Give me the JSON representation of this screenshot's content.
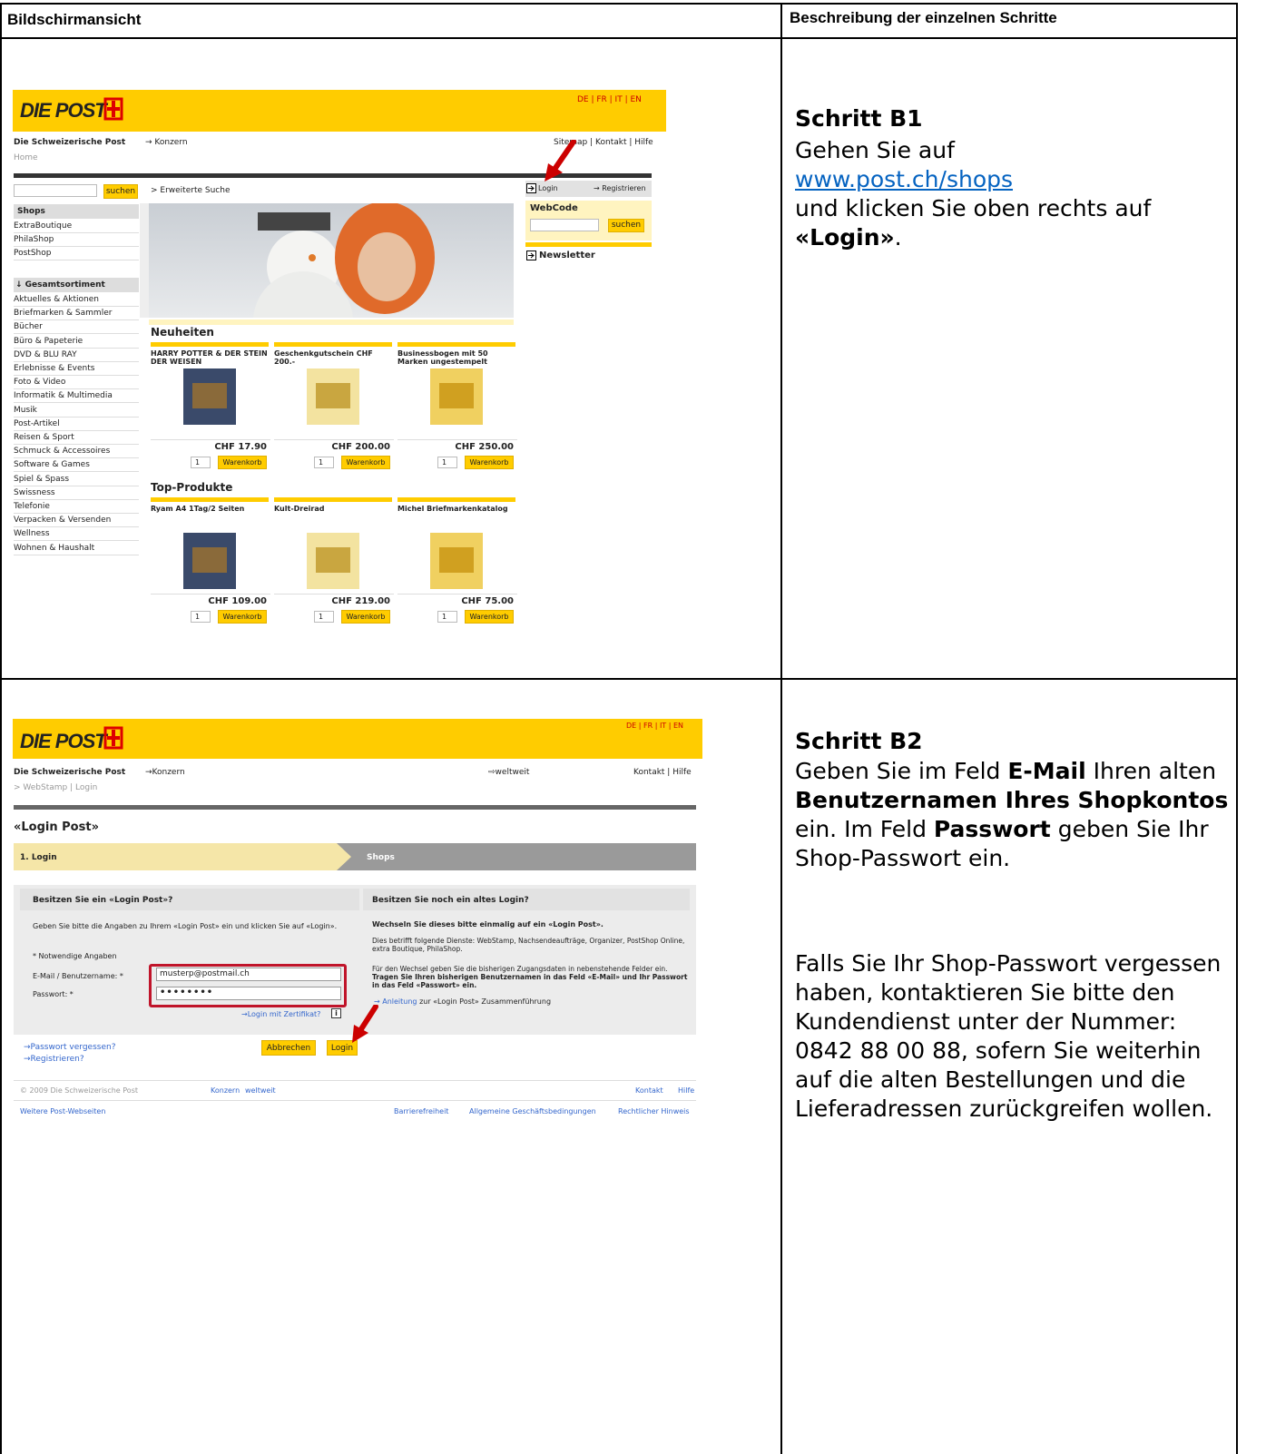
{
  "header": {
    "left": "Bildschirmansicht",
    "right": "Beschreibung der einzelnen Schritte"
  },
  "step1": {
    "title": "Schritt B1",
    "line1": "Gehen Sie auf",
    "link": "www.post.ch/shops",
    "line2": "und klicken Sie oben rechts auf",
    "bold": "«Login»",
    "dot": "."
  },
  "step2": {
    "title": "Schritt B2",
    "p1": [
      "Geben Sie im Feld ",
      "E-Mail",
      " Ihren alten ",
      "Benutzernamen Ihres Shopkontos",
      " ein. Im Feld ",
      "Passwort",
      " geben Sie Ihr Shop-Passwort ein."
    ],
    "p2": "Falls Sie Ihr Shop-Passwort vergessen haben, kontaktieren Sie bitte den Kundendienst unter der Nummer: 0842 88 00 88, sofern Sie weiterhin auf die alten Bestellungen und die Lieferadressen zurückgreifen wollen."
  },
  "shot1": {
    "logo": "DIE POST",
    "lang": "DE | FR | IT | EN",
    "org": "Die Schweizerische Post",
    "konzern": "→ Konzern",
    "toplinks": "Sitemap | Kontakt | Hilfe",
    "home": "Home",
    "search_btn": "suchen",
    "ext_search": "> Erweiterte Suche",
    "login": "Login",
    "register": "→ Registrieren",
    "webcode": "WebCode",
    "webcode_btn": "suchen",
    "newsletter": "Newsletter",
    "shops_title": "Shops",
    "shops": [
      "ExtraBoutique",
      "PhilaShop",
      "PostShop"
    ],
    "sortiment_title": "↓ Gesamtsortiment",
    "sortiment": [
      "Aktuelles & Aktionen",
      "Briefmarken & Sammler",
      "Bücher",
      "Büro & Papeterie",
      "DVD & BLU RAY",
      "Erlebnisse & Events",
      "Foto & Video",
      "Informatik & Multimedia",
      "Musik",
      "Post-Artikel",
      "Reisen & Sport",
      "Schmuck & Accessoires",
      "Software & Games",
      "Spiel & Spass",
      "Swissness",
      "Telefonie",
      "Verpacken & Versenden",
      "Wellness",
      "Wohnen & Haushalt"
    ],
    "neuheiten": "Neuheiten",
    "neu_items": [
      {
        "name": "HARRY POTTER & DER STEIN DER WEISEN",
        "price": "CHF 17.90"
      },
      {
        "name": "Geschenkgutschein CHF 200.-",
        "price": "CHF 200.00"
      },
      {
        "name": "Businessbogen mit 50 Marken ungestempelt",
        "price": "CHF 250.00"
      }
    ],
    "top": "Top-Produkte",
    "top_items": [
      {
        "name": "Ryam A4 1Tag/2 Seiten",
        "price": "CHF 109.00"
      },
      {
        "name": "Kult-Dreirad",
        "price": "CHF 219.00"
      },
      {
        "name": "Michel Briefmarkenkatalog",
        "price": "CHF 75.00"
      }
    ],
    "qty": "1",
    "cart": "Warenkorb"
  },
  "shot2": {
    "logo": "DIE POST",
    "lang": "DE | FR | IT | EN",
    "org": "Die Schweizerische Post",
    "konzern": "→Konzern",
    "weltweit": "⇨weltweit",
    "toplinks": "Kontakt | Hilfe",
    "crumb": "> WebStamp | Login",
    "page_title": "«Login Post»",
    "tab1": "1. Login",
    "tab2": "Shops",
    "left_head": "Besitzen Sie ein «Login Post»?",
    "left_text": "Geben Sie bitte die Angaben zu Ihrem «Login Post» ein und klicken Sie auf «Login».",
    "required": "* Notwendige Angaben",
    "email_label": "E-Mail / Benutzername: *",
    "email_value": "musterp@postmail.ch",
    "pw_label": "Passwort: *",
    "pw_value": "••••••••",
    "cert": "→Login mit Zertifikat?",
    "right_head": "Besitzen Sie noch ein altes Login?",
    "right_bold": "Wechseln Sie dieses bitte einmalig auf ein «Login Post».",
    "right_text1": "Dies betrifft folgende Dienste: WebStamp, Nachsendeaufträge, Organizer, PostShop Online, extra Boutique, PhilaShop.",
    "right_text2a": "Für den Wechsel geben Sie die bisherigen Zugangsdaten in nebenstehende Felder ein.",
    "right_text2b": "Tragen Sie Ihren bisherigen Benutzernamen in das Feld «E-Mail» und Ihr Passwort in das Feld «Passwort» ein.",
    "anleitung": "→ Anleitung",
    "anleitung_rest": "zur «Login Post» Zusammenführung",
    "forgot": "→Passwort vergessen?",
    "registrieren": "→Registrieren?",
    "cancel": "Abbrechen",
    "login_btn": "Login",
    "copyright": "© 2009 Die Schweizerische Post",
    "foot_konzern": "Konzern",
    "foot_weltweit": "weltweit",
    "foot_kontakt": "Kontakt",
    "foot_hilfe": "Hilfe",
    "weitere": "Weitere Post-Webseiten",
    "barriere": "Barrierefreiheit",
    "agb": "Allgemeine Geschäftsbedingungen",
    "rechtlich": "Rechtlicher Hinweis"
  },
  "colors": {
    "yellow": "#ffcc00",
    "red": "#cc0000",
    "link": "#0563c1"
  }
}
